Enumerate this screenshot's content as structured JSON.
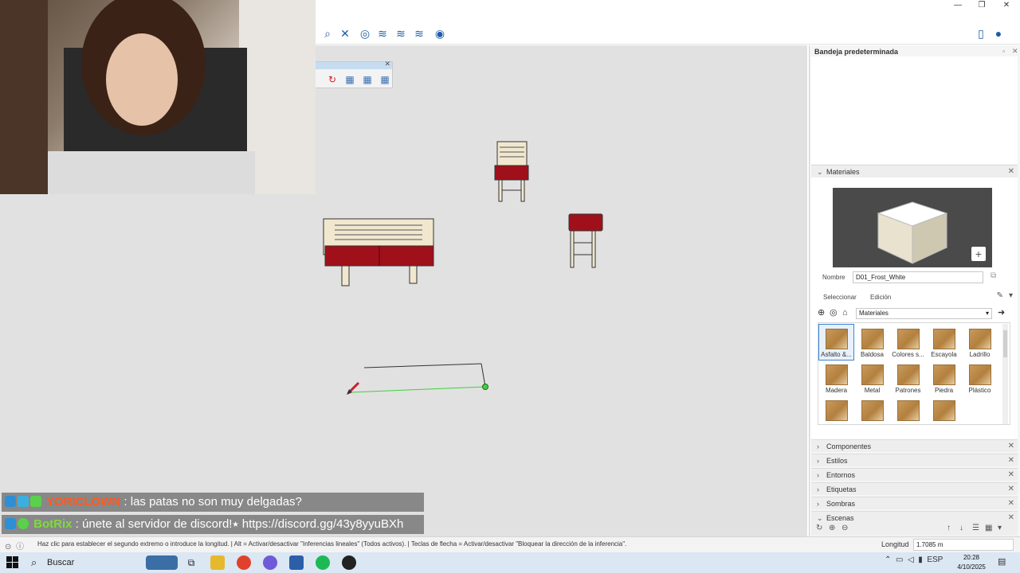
{
  "window": {
    "controls": {
      "minimize": "—",
      "restore": "❐",
      "close": "✕"
    }
  },
  "overlay_chat": [
    {
      "user": "YORICLOWN",
      "separator": " : ",
      "message": "las patas no son muy delgadas?"
    },
    {
      "user": "BotRix",
      "separator": " : ",
      "message": "únete al servidor de discord!⭑ https://discord.gg/43y8yyuBXh"
    }
  ],
  "tray": {
    "title": "Bandeja predeterminada",
    "materials": {
      "header": "Materiales",
      "name_label": "Nombre",
      "name_value": "D01_Frost_White",
      "tabs": [
        "Seleccionar",
        "Edición"
      ],
      "collection": "Materiales",
      "swatches": [
        {
          "label": "Asfalto &...",
          "selected": true
        },
        {
          "label": "Baldosa",
          "selected": false
        },
        {
          "label": "Colores s...",
          "selected": false
        },
        {
          "label": "Escayola",
          "selected": false
        },
        {
          "label": "Ladrillo",
          "selected": false
        },
        {
          "label": "Madera",
          "selected": false
        },
        {
          "label": "Metal",
          "selected": false
        },
        {
          "label": "Patrones",
          "selected": false
        },
        {
          "label": "Piedra",
          "selected": false
        },
        {
          "label": "Plástico",
          "selected": false
        },
        {
          "label": "",
          "selected": false
        },
        {
          "label": "",
          "selected": false
        },
        {
          "label": "",
          "selected": false
        },
        {
          "label": "",
          "selected": false
        }
      ]
    },
    "sections": [
      "Componentes",
      "Estilos",
      "Entornos",
      "Etiquetas",
      "Sombras",
      "Escenas"
    ]
  },
  "statusbar": {
    "hint": "Haz clic para establecer el segundo extremo o introduce la longitud. | Alt = Activar/desactivar \"Inferencias lineales\" (Todos activos). | Teclas de flecha = Activar/desactivar \"Bloquear la dirección de la inferencia\".",
    "measure_label": "Longitud",
    "measure_value": "1.7085 m"
  },
  "taskbar": {
    "search_placeholder": "Buscar",
    "language": "ESP",
    "time": "20:28",
    "date": "4/10/2025"
  },
  "colors": {
    "viewport_bg": "#e1e1e1",
    "cushion_red": "#a0101a",
    "wood": "#f1e7cf",
    "accent_blue": "#1e5da8",
    "inference_green": "#3fcf3f"
  }
}
